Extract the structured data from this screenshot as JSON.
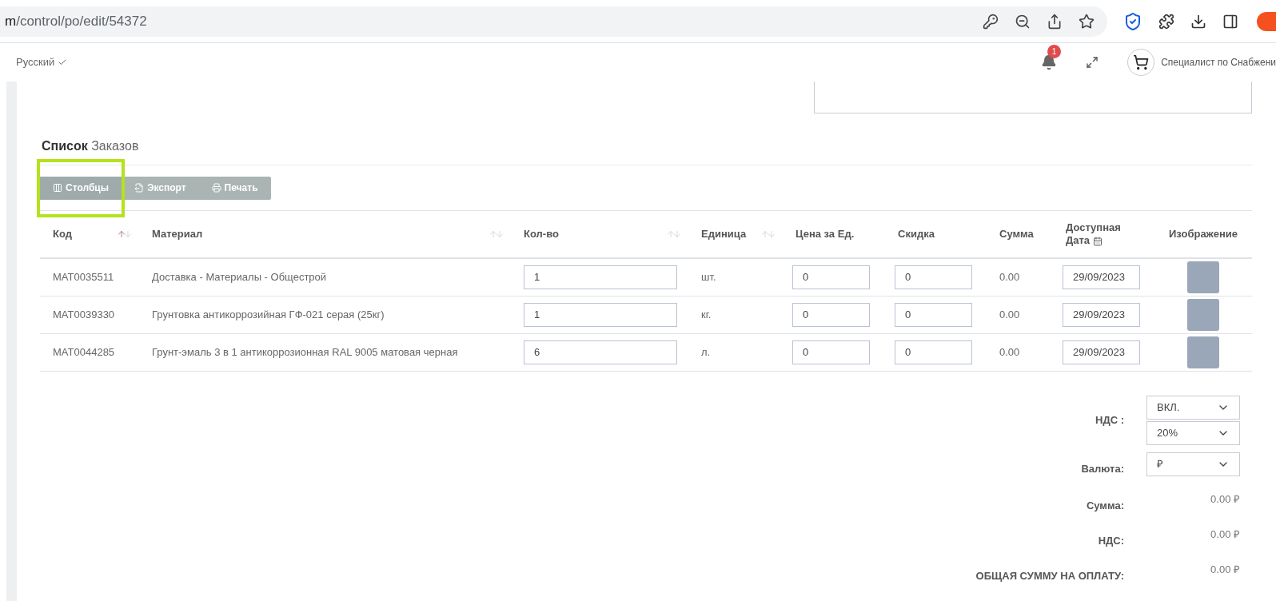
{
  "browser": {
    "url_host": "m",
    "url_path": "/control/po/edit/54372"
  },
  "header": {
    "language": "Русский",
    "notifications": "1",
    "user": "Специалист по Снабжени"
  },
  "section": {
    "title_bold": "Список",
    "title_rest": "Заказов"
  },
  "toolbar": [
    {
      "label": "Столбцы",
      "kind": "columns",
      "highlighted": true
    },
    {
      "label": "Экспорт",
      "kind": "export",
      "highlighted": false
    },
    {
      "label": "Печать",
      "kind": "print",
      "highlighted": false
    }
  ],
  "table": {
    "columns": [
      {
        "label": "Код",
        "sorted": true
      },
      {
        "label": "Материал",
        "sorted": false
      },
      {
        "label": "Кол-во",
        "sorted": false
      },
      {
        "label": "Единица",
        "sorted": false
      },
      {
        "label": "Цена за Ед."
      },
      {
        "label": "Скидка"
      },
      {
        "label": "Сумма"
      },
      {
        "label": "Доступная Дата",
        "calendar": true
      },
      {
        "label": "Изображение"
      }
    ],
    "rows": [
      {
        "code": "MAT0035511",
        "material": "Доставка - Материалы - Общестрой",
        "qty": "1",
        "unit": "шт.",
        "price": "0",
        "discount": "0",
        "sum": "0.00",
        "date": "29/09/2023"
      },
      {
        "code": "MAT0039330",
        "material": "Грунтовка антикоррозийная ГФ-021 серая (25кг)",
        "qty": "1",
        "unit": "кг.",
        "price": "0",
        "discount": "0",
        "sum": "0.00",
        "date": "29/09/2023"
      },
      {
        "code": "MAT0044285",
        "material": "Грунт-эмаль 3 в 1 антикоррозионная RAL 9005 матовая черная",
        "qty": "6",
        "unit": "л.",
        "price": "0",
        "discount": "0",
        "sum": "0.00",
        "date": "29/09/2023"
      }
    ]
  },
  "summary": {
    "vat_label": "НДС :",
    "vat_mode": "ВКЛ.",
    "vat_rate": "20%",
    "currency_label": "Валюта:",
    "currency": "₽",
    "totals": [
      {
        "label": "Сумма:",
        "value": "0.00 ₽"
      },
      {
        "label": "НДС:",
        "value": "0.00 ₽"
      },
      {
        "label": "ОБЩАЯ СУММУ НА ОПЛАТУ:",
        "value": "0.00 ₽"
      }
    ]
  }
}
